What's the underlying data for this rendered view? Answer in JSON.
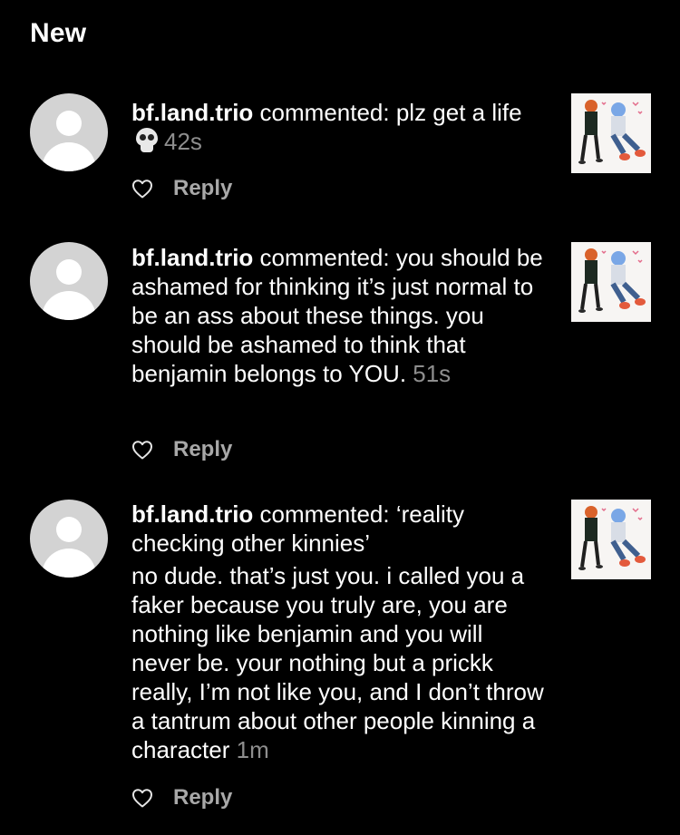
{
  "section": {
    "title": "New"
  },
  "notifications": [
    {
      "username": "bf.land.trio",
      "lead": " commented: plz get a life",
      "emoji": "skull-emoji",
      "time": "42s",
      "reply_label": "Reply"
    },
    {
      "username": "bf.land.trio",
      "lead": " commented: you should be ashamed for thinking it’s just normal to be an ass about these things. you should be ashamed to think that benjamin belongs to YOU. ",
      "time": "51s",
      "reply_label": "Reply"
    },
    {
      "username": "bf.land.trio",
      "lead": " commented: ‘reality checking other kinnies’",
      "body": "no dude. that’s just you. i called you a faker because you truly are, you are nothing like benjamin and you will never be. your nothing but a prickk really, I’m not like you, and I don’t throw a tantrum about other people kinning a character ",
      "time": "1m",
      "reply_label": "Reply"
    }
  ],
  "icons": {
    "avatar": "default-profile-avatar",
    "like": "heart-outline-icon",
    "thumbnail": "post-thumbnail-drawing"
  },
  "colors": {
    "background": "#000000",
    "text": "#ffffff",
    "muted": "#8e8e8e",
    "reply": "#a8a8a8",
    "avatar_bg": "#d3d3d3"
  }
}
